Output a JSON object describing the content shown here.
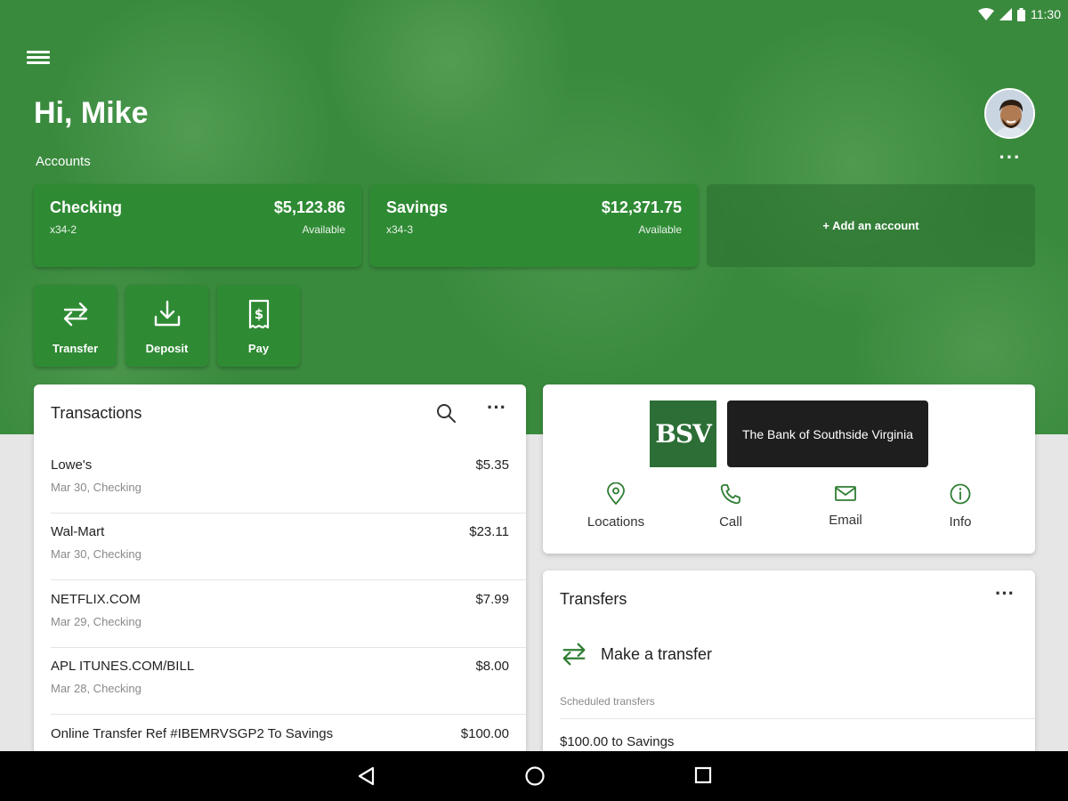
{
  "status_bar": {
    "time": "11:30"
  },
  "header": {
    "greeting": "Hi, Mike"
  },
  "accounts": {
    "label": "Accounts",
    "cards": [
      {
        "name": "Checking",
        "number": "x34-2",
        "balance": "$5,123.86",
        "available_label": "Available"
      },
      {
        "name": "Savings",
        "number": "x34-3",
        "balance": "$12,371.75",
        "available_label": "Available"
      }
    ],
    "add_label": "+ Add an account"
  },
  "quick_actions": [
    {
      "label": "Transfer",
      "icon": "transfer-icon"
    },
    {
      "label": "Deposit",
      "icon": "deposit-icon"
    },
    {
      "label": "Pay",
      "icon": "bill-pay-icon"
    }
  ],
  "transactions": {
    "title": "Transactions",
    "rows": [
      {
        "desc": "Lowe's",
        "meta": "Mar 30, Checking",
        "amount": "$5.35"
      },
      {
        "desc": "Wal-Mart",
        "meta": "Mar 30, Checking",
        "amount": "$23.11"
      },
      {
        "desc": "NETFLIX.COM",
        "meta": "Mar 29, Checking",
        "amount": "$7.99"
      },
      {
        "desc": "APL ITUNES.COM/BILL",
        "meta": "Mar 28, Checking",
        "amount": "$8.00"
      },
      {
        "desc": "Online Transfer Ref #IBEMRVSGP2 To Savings",
        "meta": "",
        "amount": "$100.00"
      }
    ]
  },
  "bank": {
    "logo_short": "BSV",
    "logo_name": "The Bank of Southside Virginia",
    "actions": [
      {
        "label": "Locations",
        "icon": "location-pin-icon"
      },
      {
        "label": "Call",
        "icon": "phone-icon"
      },
      {
        "label": "Email",
        "icon": "envelope-icon"
      },
      {
        "label": "Info",
        "icon": "info-icon"
      }
    ]
  },
  "transfers": {
    "title": "Transfers",
    "make_label": "Make a transfer",
    "scheduled_label": "Scheduled transfers",
    "scheduled": [
      {
        "label": "$100.00 to Savings"
      }
    ]
  },
  "colors": {
    "brand_green": "#2f8a34",
    "icon_green": "#2e7d32"
  }
}
